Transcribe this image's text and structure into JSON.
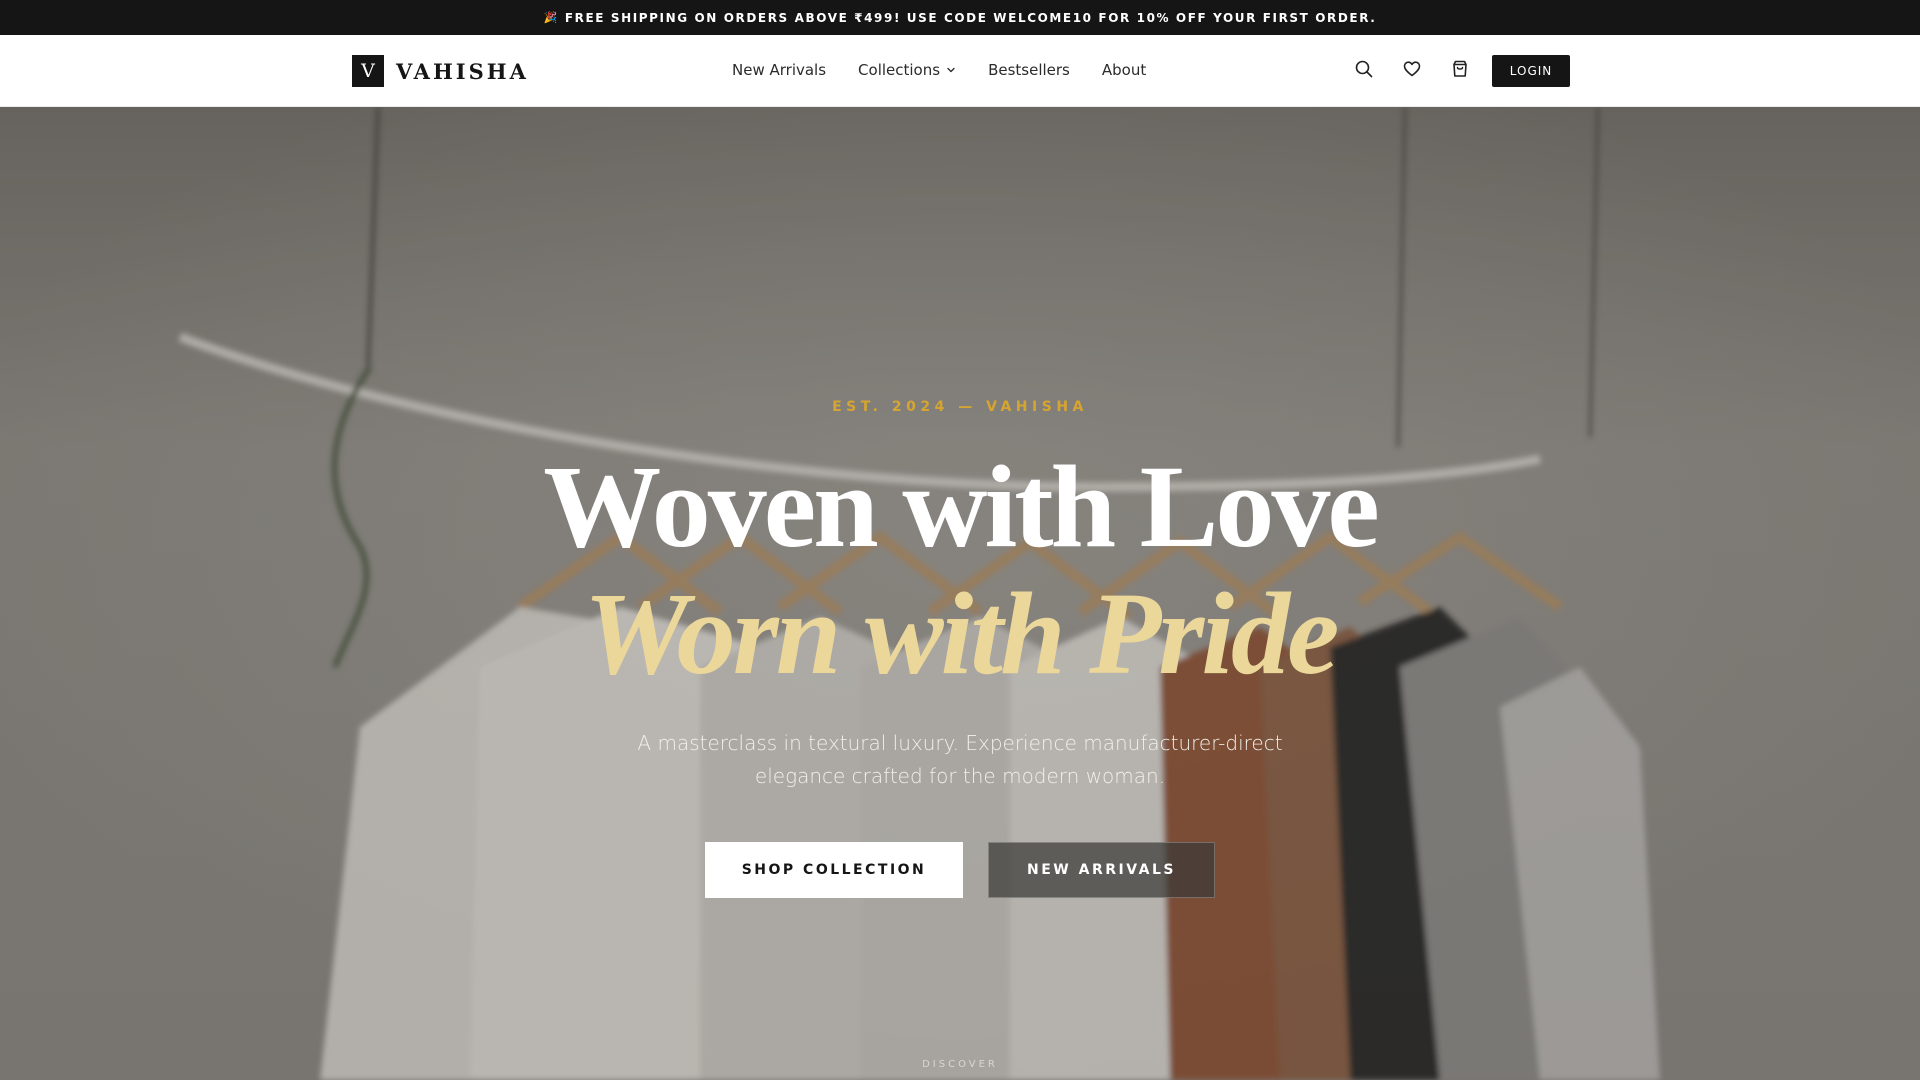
{
  "announcement": {
    "emoji": "🎉",
    "text": "FREE SHIPPING ON ORDERS ABOVE ₹499! USE CODE WELCOME10 FOR 10% OFF YOUR FIRST ORDER."
  },
  "header": {
    "logo_mark": "V",
    "logo_text": "VAHISHA",
    "nav": [
      {
        "label": "New Arrivals",
        "icon": null
      },
      {
        "label": "Collections",
        "icon": "chevron-down-icon"
      },
      {
        "label": "Bestsellers",
        "icon": null
      },
      {
        "label": "About",
        "icon": null
      }
    ],
    "actions": {
      "search_icon": "search-icon",
      "wishlist_icon": "heart-icon",
      "cart_icon": "shopping-bag-icon",
      "login_label": "LOGIN"
    }
  },
  "hero": {
    "eyebrow": "EST. 2024 — VAHISHA",
    "headline_line1": "Woven with Love",
    "headline_line2": "Worn with Pride",
    "subtext": "A masterclass in textural luxury. Experience manufacturer-direct elegance crafted for the modern woman.",
    "cta_primary": "SHOP COLLECTION",
    "cta_secondary": "NEW ARRIVALS",
    "discover": "DISCOVER"
  },
  "colors": {
    "dark": "#151515",
    "accent_gold": "#d6a531",
    "headline_gold": "#ecd79a",
    "white": "#ffffff"
  }
}
